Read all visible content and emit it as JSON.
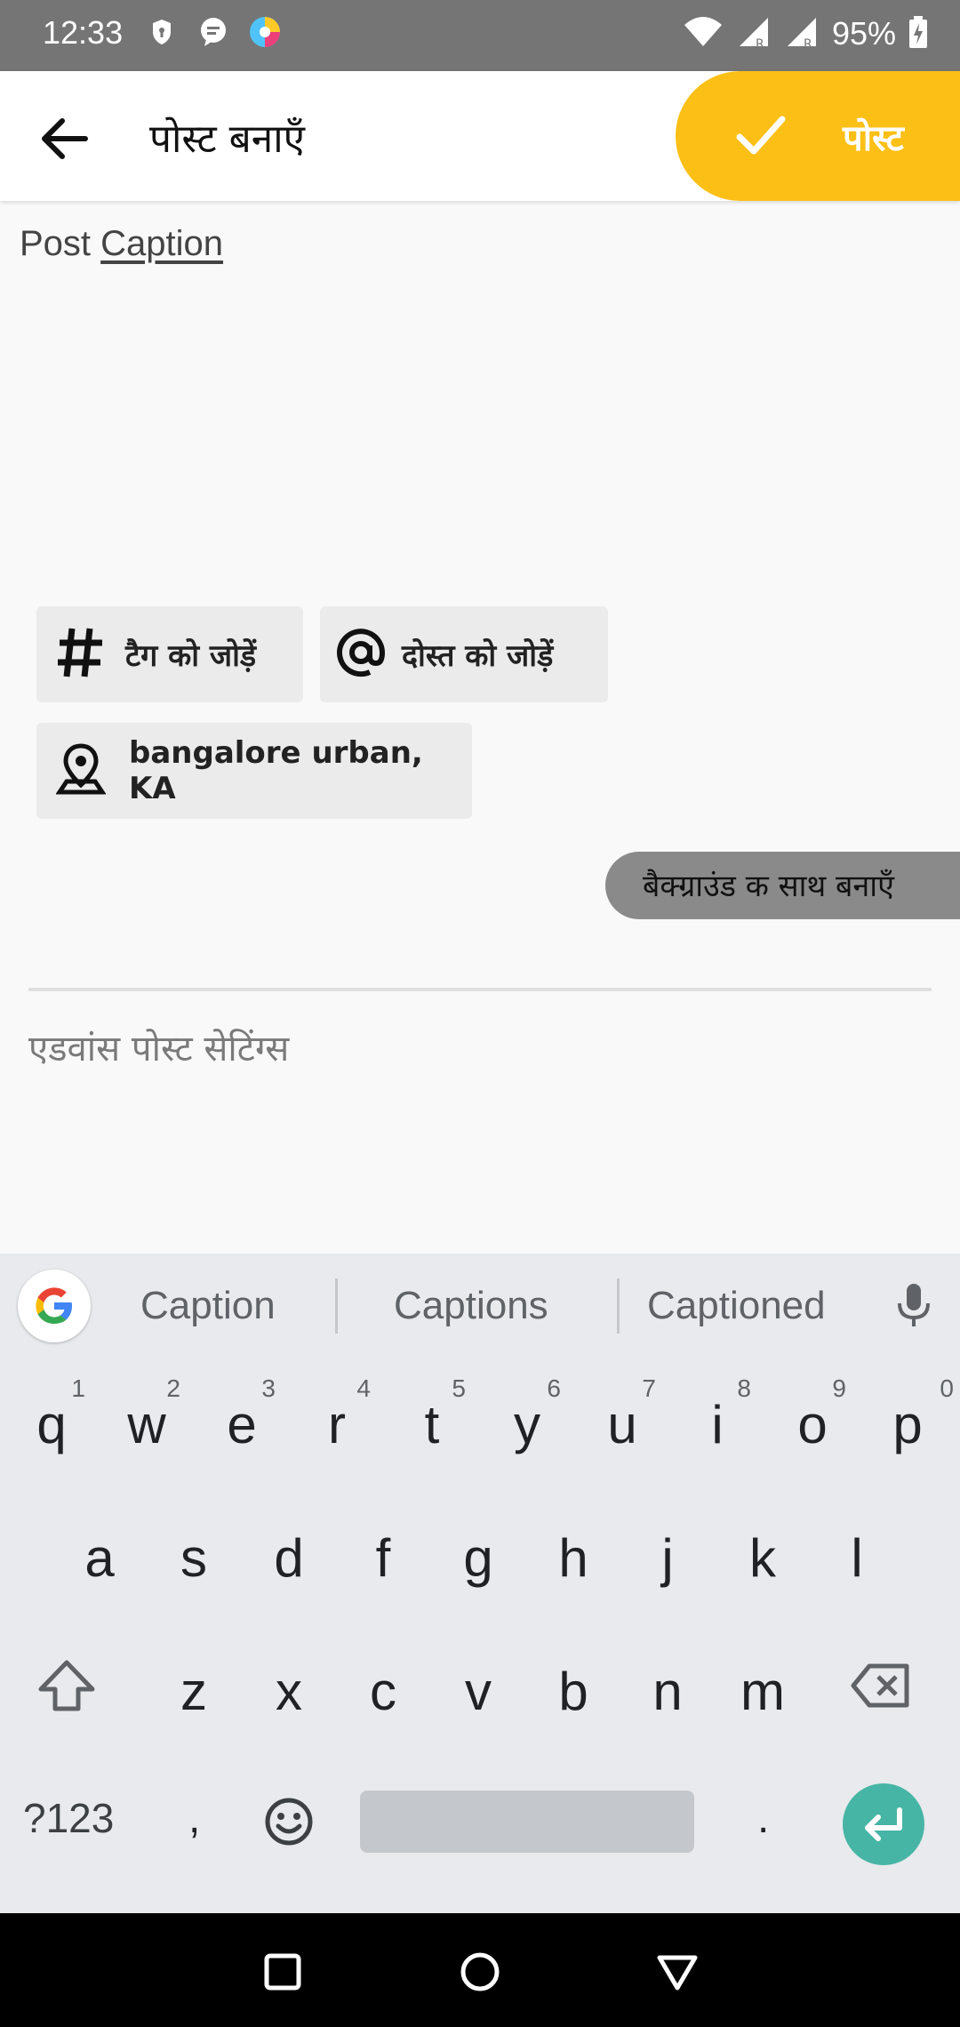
{
  "status_bar": {
    "time": "12:33",
    "battery": "95%",
    "icons": [
      "shield-icon",
      "chat-bubble-icon",
      "app-color-icon",
      "wifi-icon",
      "signal-r-icon",
      "signal-r-icon",
      "battery-charging-icon"
    ]
  },
  "app_bar": {
    "title": "पोस्ट बनाएँ",
    "post_button": "पोस्ट",
    "accent_color": "#fbbf16"
  },
  "composer": {
    "caption_prefix": "Post ",
    "caption_word": "Caption"
  },
  "chips": {
    "tag": "टैग को जोड़ें",
    "friend": "दोस्त को जोड़ें",
    "location": "bangalore urban, KA"
  },
  "background_toggle": "बैक्ग्राउंड क साथ बनाएँ",
  "advanced_settings": "एडवांस पोस्ट सेटिंग्स",
  "keyboard": {
    "suggestions": [
      "Caption",
      "Captions",
      "Captioned"
    ],
    "row1": [
      "q",
      "w",
      "e",
      "r",
      "t",
      "y",
      "u",
      "i",
      "o",
      "p"
    ],
    "row1_numbers": [
      "1",
      "2",
      "3",
      "4",
      "5",
      "6",
      "7",
      "8",
      "9",
      "0"
    ],
    "row2": [
      "a",
      "s",
      "d",
      "f",
      "g",
      "h",
      "j",
      "k",
      "l"
    ],
    "row3": [
      "z",
      "x",
      "c",
      "v",
      "b",
      "n",
      "m"
    ],
    "symbols_key": "?123",
    "comma_key": ",",
    "period_key": ".",
    "enter_color": "#47b5a5"
  }
}
